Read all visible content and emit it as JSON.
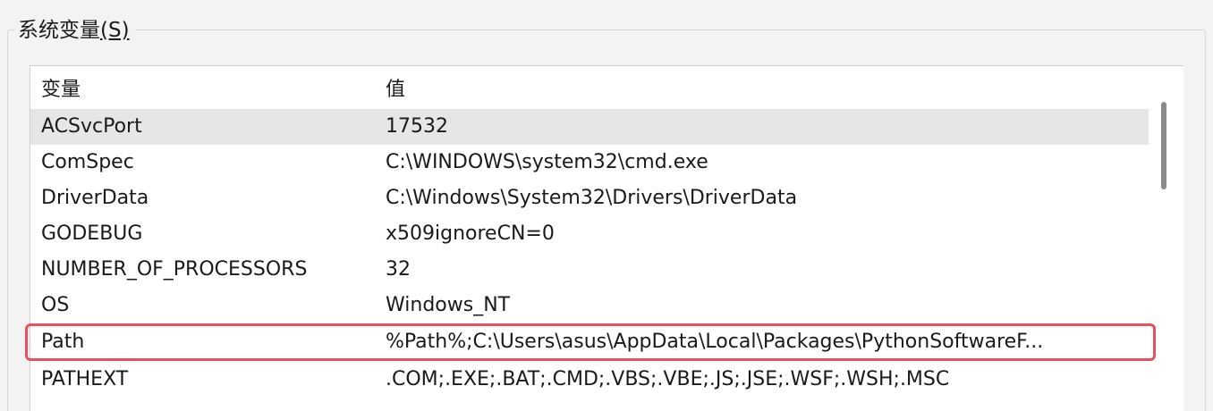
{
  "group": {
    "title": "系统变量",
    "accel": "(S)"
  },
  "table": {
    "headers": {
      "variable": "变量",
      "value": "值"
    },
    "rows": [
      {
        "name": "ACSvcPort",
        "value": "17532"
      },
      {
        "name": "ComSpec",
        "value": "C:\\WINDOWS\\system32\\cmd.exe"
      },
      {
        "name": "DriverData",
        "value": "C:\\Windows\\System32\\Drivers\\DriverData"
      },
      {
        "name": "GODEBUG",
        "value": "x509ignoreCN=0"
      },
      {
        "name": "NUMBER_OF_PROCESSORS",
        "value": "32"
      },
      {
        "name": "OS",
        "value": "Windows_NT"
      },
      {
        "name": "Path",
        "value": "%Path%;C:\\Users\\asus\\AppData\\Local\\Packages\\PythonSoftwareF..."
      },
      {
        "name": "PATHEXT",
        "value": ".COM;.EXE;.BAT;.CMD;.VBS;.VBE;.JS;.JSE;.WSF;.WSH;.MSC"
      }
    ],
    "selected_index": 0,
    "highlighted_index": 6
  },
  "colors": {
    "highlight_border": "#e8505e",
    "selected_row": "#e6e6e6",
    "background": "#f3f3f3"
  }
}
